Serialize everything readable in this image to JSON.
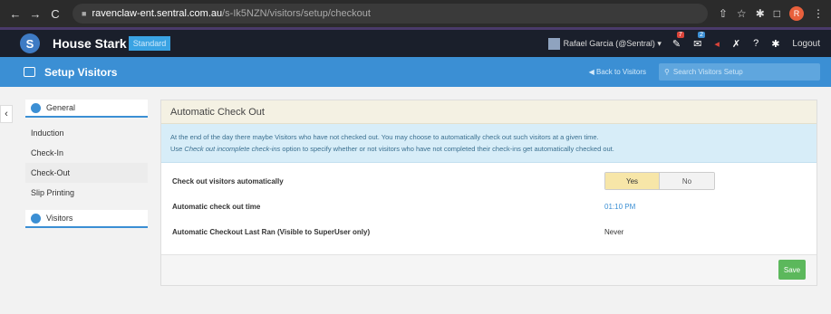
{
  "browser": {
    "url_host": "ravenclaw-ent.sentral.com.au",
    "url_path": "/s-Ik5NZN/visitors/setup/checkout",
    "profile_initial": "R"
  },
  "header": {
    "brand": "House Stark",
    "edition": "Standard",
    "user": "Rafael Garcia (@Sentral) ▾",
    "badge1": "7",
    "badge2": "2",
    "logout": "Logout"
  },
  "toolbar": {
    "title": "Setup Visitors",
    "back": "◀ Back to Visitors",
    "search_placeholder": "Search Visitors Setup"
  },
  "sidebar": {
    "group1": "General",
    "items": [
      "Induction",
      "Check-In",
      "Check-Out",
      "Slip Printing"
    ],
    "group2": "Visitors"
  },
  "panel": {
    "title": "Automatic Check Out",
    "info_line1": "At the end of the day there maybe Visitors who have not checked out. You may choose to automatically check out such visitors at a given time.",
    "info_line2_prefix": "Use ",
    "info_line2_em": "Check out incomplete check-ins",
    "info_line2_suffix": " option to specify whether or not visitors who have not completed their check-ins get automatically checked out.",
    "rows": [
      {
        "label": "Check out visitors automatically"
      },
      {
        "label": "Automatic check out time",
        "value": "01:10 PM"
      },
      {
        "label": "Automatic Checkout Last Ran (Visible to SuperUser only)",
        "value": "Never"
      }
    ],
    "toggle_yes": "Yes",
    "toggle_no": "No",
    "save": "Save"
  },
  "colors": {
    "accent": "#3b8fd4",
    "save": "#5cb85c",
    "header_bg": "#1a1f2b"
  }
}
